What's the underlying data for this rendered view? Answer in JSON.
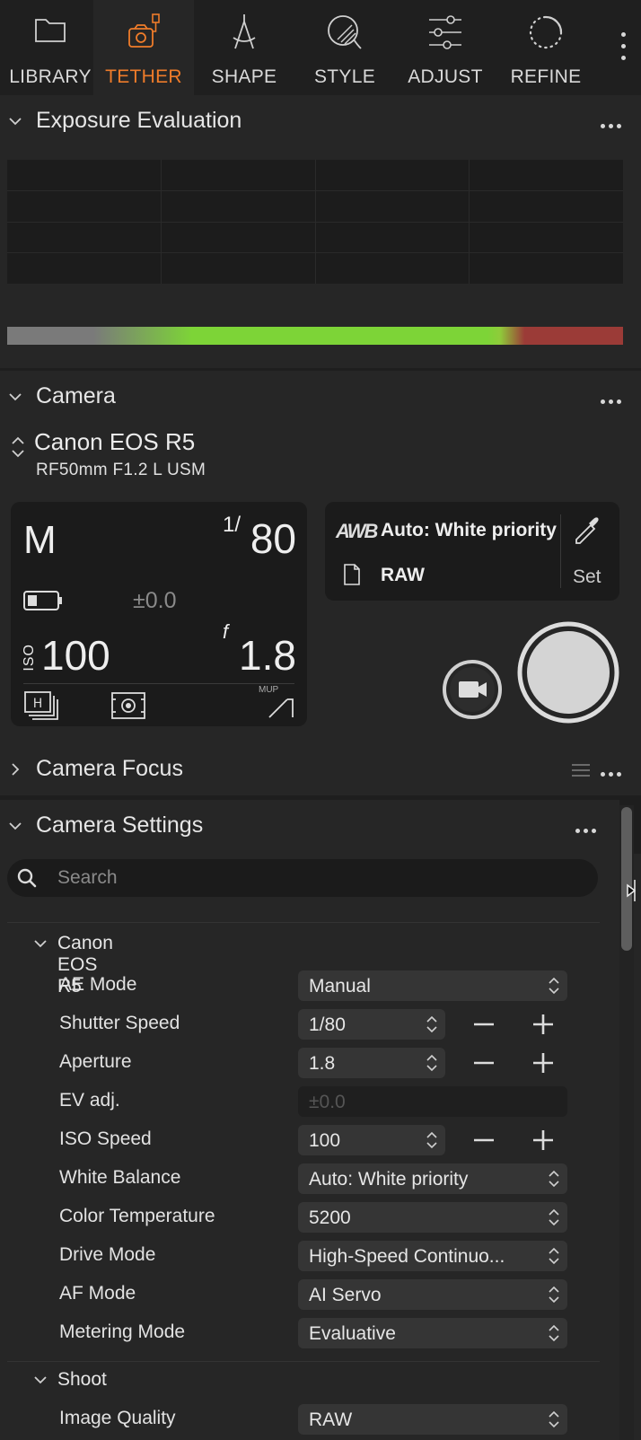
{
  "toolbar": {
    "tabs": [
      {
        "label": "LIBRARY",
        "icon": "folder-icon",
        "active": false
      },
      {
        "label": "TETHER",
        "icon": "tether-camera-icon",
        "active": true
      },
      {
        "label": "SHAPE",
        "icon": "shape-compass-icon",
        "active": false
      },
      {
        "label": "STYLE",
        "icon": "style-palette-icon",
        "active": false
      },
      {
        "label": "ADJUST",
        "icon": "adjust-sliders-icon",
        "active": false
      },
      {
        "label": "REFINE",
        "icon": "refine-dotted-circle-icon",
        "active": false
      }
    ],
    "accent_color": "#ef7c2a"
  },
  "exposure": {
    "title": "Exposure Evaluation"
  },
  "camera": {
    "title": "Camera",
    "model": "Canon EOS R5",
    "lens": "RF50mm F1.2 L USM",
    "readout": {
      "mode": "M",
      "shutter_fraction": "1/",
      "shutter": "80",
      "ev": "±0.0",
      "iso_label": "ISO",
      "iso": "100",
      "aperture_label": "f",
      "aperture": "1.8",
      "mup_label": "MUP"
    },
    "white_balance": "Auto: White priority",
    "wb_icon_text": "AWB",
    "file_format": "RAW",
    "set_label": "Set"
  },
  "camera_focus": {
    "title": "Camera Focus"
  },
  "camera_settings": {
    "title": "Camera Settings",
    "search_placeholder": "Search",
    "groups": [
      {
        "title": "Canon EOS R5",
        "rows": [
          {
            "label": "AE Mode",
            "value": "Manual",
            "stepper": false,
            "disabled": false
          },
          {
            "label": "Shutter Speed",
            "value": "1/80",
            "stepper": true,
            "disabled": false
          },
          {
            "label": "Aperture",
            "value": "1.8",
            "stepper": true,
            "disabled": false
          },
          {
            "label": "EV adj.",
            "value": "±0.0",
            "stepper": false,
            "disabled": true
          },
          {
            "label": "ISO Speed",
            "value": "100",
            "stepper": true,
            "disabled": false
          },
          {
            "label": "White Balance",
            "value": "Auto: White priority",
            "stepper": false,
            "disabled": false
          },
          {
            "label": "Color Temperature",
            "value": "5200",
            "stepper": false,
            "disabled": false
          },
          {
            "label": "Drive Mode",
            "value": "High-Speed Continuo...",
            "stepper": false,
            "disabled": false
          },
          {
            "label": "AF Mode",
            "value": "AI Servo",
            "stepper": false,
            "disabled": false
          },
          {
            "label": "Metering Mode",
            "value": "Evaluative",
            "stepper": false,
            "disabled": false
          }
        ]
      },
      {
        "title": "Shoot",
        "rows": [
          {
            "label": "Image Quality",
            "value": "RAW",
            "stepper": false,
            "disabled": false
          }
        ]
      }
    ]
  }
}
